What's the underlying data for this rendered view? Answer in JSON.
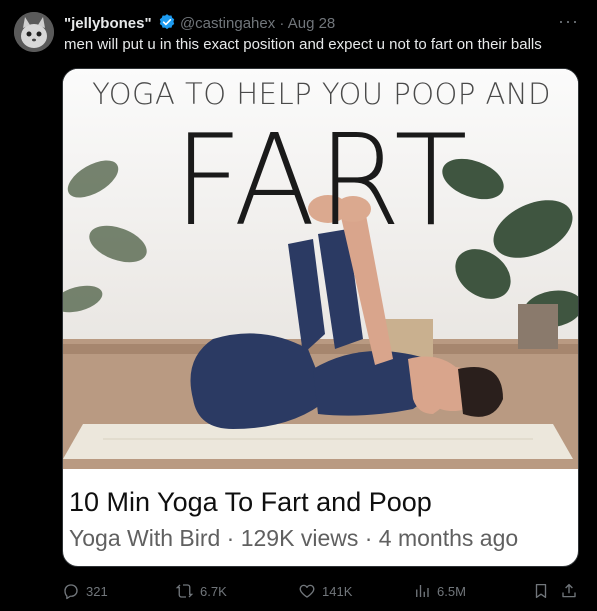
{
  "post": {
    "display_name": "\"jellybones\"",
    "handle": "@castingahex",
    "separator": "·",
    "date": "Aug 28",
    "text": "men will put u in this exact position and expect u not to fart on their balls",
    "more_label": "···"
  },
  "media": {
    "overlay_top": "YOGA TO HELP YOU POOP AND",
    "overlay_big": "FART",
    "video_title": "10 Min Yoga To Fart and Poop",
    "video_meta": "Yoga With Bird · 129K views · 4 months ago"
  },
  "actions": {
    "replies": "321",
    "reposts": "6.7K",
    "likes": "141K",
    "views": "6.5M"
  },
  "colors": {
    "background": "#000000",
    "text": "#e7e9ea",
    "muted": "#71767b",
    "verified": "#1d9bf0"
  },
  "icons": [
    "avatar",
    "verified-badge-icon",
    "more-icon",
    "reply-icon",
    "repost-icon",
    "like-icon",
    "views-icon",
    "bookmark-icon",
    "share-icon"
  ]
}
